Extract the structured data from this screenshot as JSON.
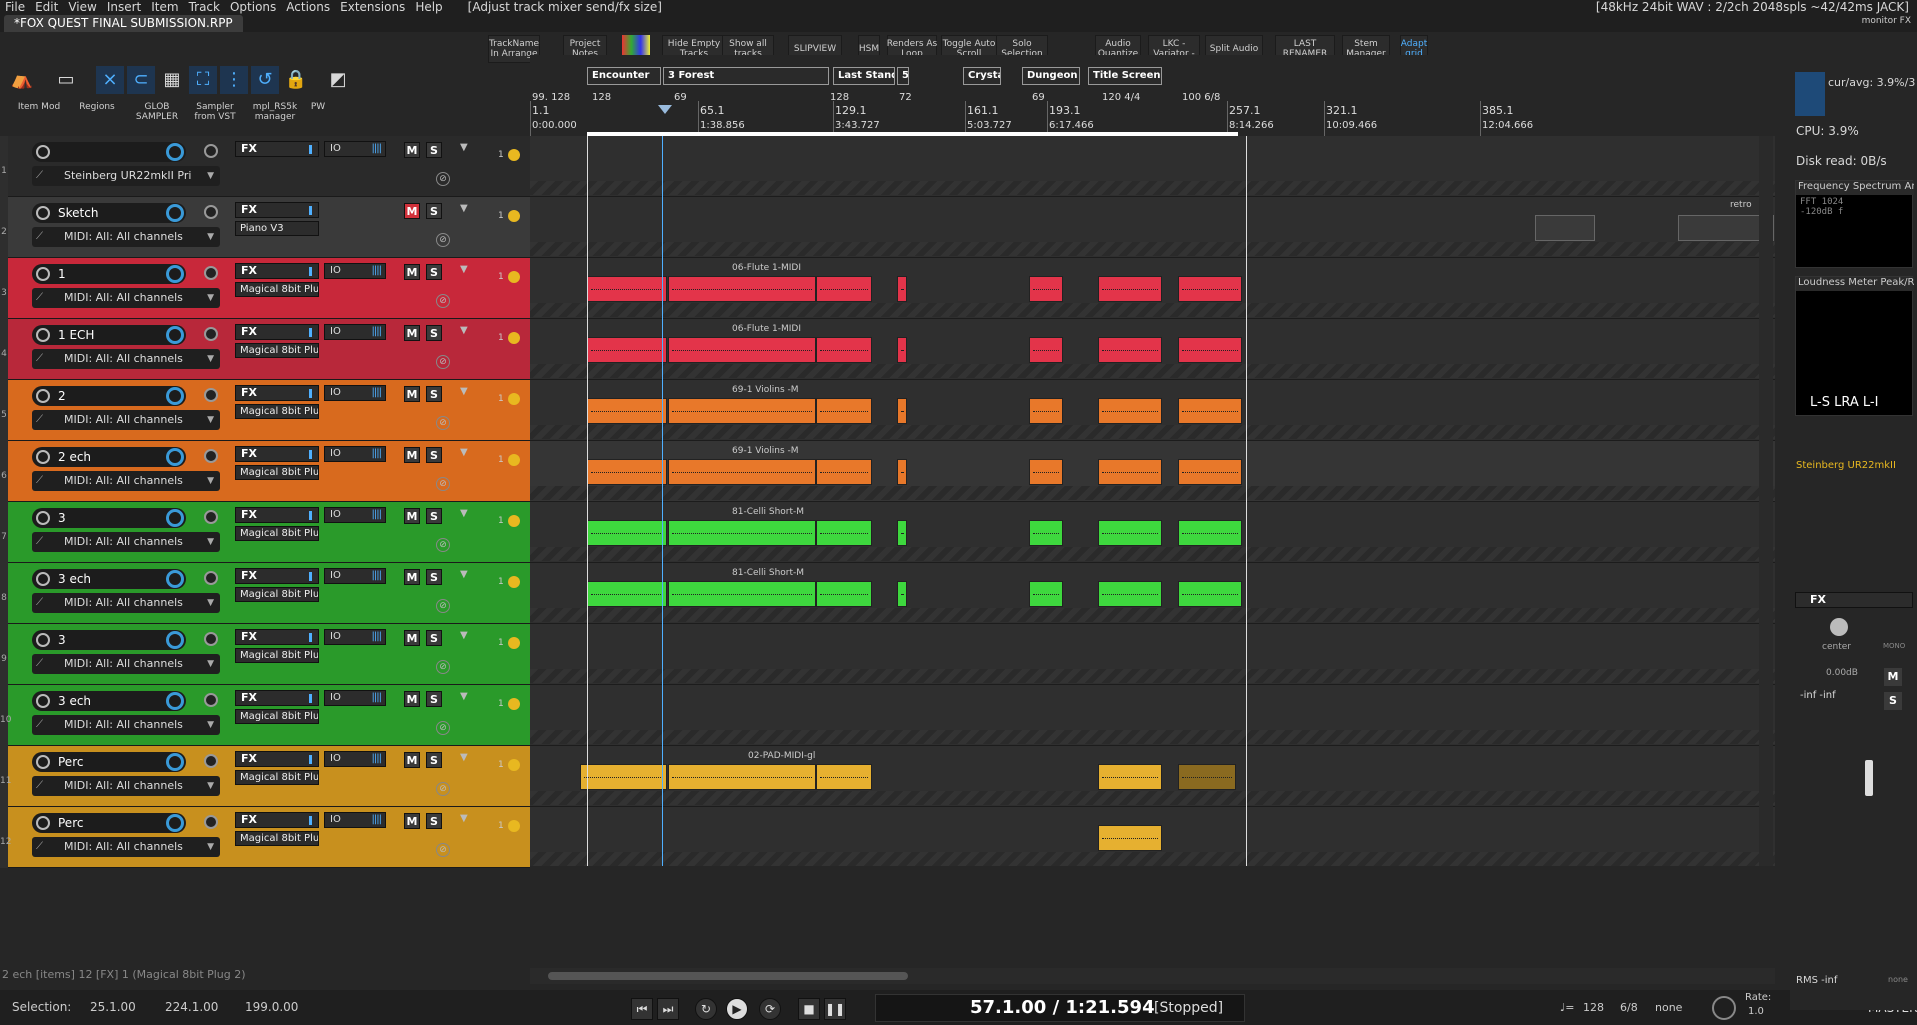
{
  "menu": {
    "items": [
      "File",
      "Edit",
      "View",
      "Insert",
      "Item",
      "Track",
      "Options",
      "Actions",
      "Extensions",
      "Help"
    ],
    "message": "[Adjust track mixer send/fx size]",
    "right": "[48kHz 24bit WAV : 2/2ch 2048spls ~42/42ms JACK]"
  },
  "tab": {
    "title": "*FOX QUEST FINAL SUBMISSION.RPP",
    "monitor": "monitor FX"
  },
  "toolbar": {
    "buttons": [
      {
        "label": "TrackName\nIn Arrange",
        "active": false
      },
      {
        "label": "Project\nNotes",
        "active": false
      },
      {
        "label": "Hide Empty\nTracks",
        "active": false
      },
      {
        "label": "Show all\ntracks",
        "active": false
      },
      {
        "label": "SLIPVIEW",
        "active": false
      },
      {
        "label": "HSM",
        "active": false
      },
      {
        "label": "Renders As\nLoop",
        "active": false
      },
      {
        "label": "Toggle Auto\nScroll",
        "active": false
      },
      {
        "label": "Solo\nSelection",
        "active": false
      },
      {
        "label": "Audio\nQuantize",
        "active": false
      },
      {
        "label": "LKC -\nVariator -",
        "active": false
      },
      {
        "label": "Split Audio",
        "active": false
      },
      {
        "label": "LAST\nRENAMER",
        "active": false
      },
      {
        "label": "Stem\nManager",
        "active": false
      },
      {
        "label": "Adapt\ngrid",
        "active": true
      }
    ],
    "left_labels": [
      "Item Mod",
      "Regions",
      "GLOB\nSAMPLER",
      "Sampler\nfrom VST",
      "mpl_RS5k\nmanager",
      "PW"
    ]
  },
  "tracks": [
    {
      "num": "1",
      "name": "",
      "fx": "FX",
      "io": "IO",
      "plugin": "",
      "route": "Steinberg UR22mkII Pri",
      "color": "#2a2a2a",
      "mute": false,
      "rec": "1"
    },
    {
      "num": "2",
      "name": "Sketch",
      "fx": "FX",
      "io": "",
      "plugin": "Piano V3",
      "route": "MIDI: All: All channels",
      "color": "#3a3a3a",
      "mute": true,
      "rec": "1"
    },
    {
      "num": "3",
      "name": "1",
      "fx": "FX",
      "io": "IO",
      "plugin": "Magical 8bit Plug",
      "route": "MIDI: All: All channels",
      "color": "#c8283a",
      "mute": false,
      "rec": "1"
    },
    {
      "num": "4",
      "name": "1 ECH",
      "fx": "FX",
      "io": "IO",
      "plugin": "Magical 8bit Plug",
      "route": "MIDI: All: All channels",
      "color": "#b8283a",
      "mute": false,
      "rec": "1"
    },
    {
      "num": "5",
      "name": "2",
      "fx": "FX",
      "io": "IO",
      "plugin": "Magical 8bit Plug",
      "route": "MIDI: All: All channels",
      "color": "#d86a1e",
      "mute": false,
      "rec": "1"
    },
    {
      "num": "6",
      "name": "2 ech",
      "fx": "FX",
      "io": "IO",
      "plugin": "Magical 8bit Plug",
      "route": "MIDI: All: All channels",
      "color": "#d86a1e",
      "mute": false,
      "rec": "1"
    },
    {
      "num": "7",
      "name": "3",
      "fx": "FX",
      "io": "IO",
      "plugin": "Magical 8bit Plug",
      "route": "MIDI: All: All channels",
      "color": "#2a9a2a",
      "mute": false,
      "rec": "1"
    },
    {
      "num": "8",
      "name": "3 ech",
      "fx": "FX",
      "io": "IO",
      "plugin": "Magical 8bit Plug",
      "route": "MIDI: All: All channels",
      "color": "#2a9a2a",
      "mute": false,
      "rec": "1"
    },
    {
      "num": "9",
      "name": "3",
      "fx": "FX",
      "io": "IO",
      "plugin": "Magical 8bit Plug",
      "route": "MIDI: All: All channels",
      "color": "#2a9a2a",
      "mute": false,
      "rec": "1"
    },
    {
      "num": "10",
      "name": "3 ech",
      "fx": "FX",
      "io": "IO",
      "plugin": "Magical 8bit Plug",
      "route": "MIDI: All: All channels",
      "color": "#2a9a2a",
      "mute": false,
      "rec": "1"
    },
    {
      "num": "11",
      "name": "Perc",
      "fx": "FX",
      "io": "IO",
      "plugin": "Magical 8bit Plug",
      "route": "MIDI: All: All channels",
      "color": "#c8901e",
      "mute": false,
      "rec": "1"
    },
    {
      "num": "12",
      "name": "Perc",
      "fx": "FX",
      "io": "IO",
      "plugin": "Magical 8bit Plug",
      "route": "MIDI: All: All channels",
      "color": "#c8901e",
      "mute": false,
      "rec": "1"
    }
  ],
  "regions": [
    "Encounter",
    "3 Forest",
    "Last Stand",
    "5",
    "Crysta",
    "Dungeon",
    "Title Screen"
  ],
  "ruler": {
    "marks": [
      {
        "bar": "1.1",
        "time": "0:00.000"
      },
      {
        "bar": "65.1",
        "time": "1:38.856"
      },
      {
        "bar": "129.1",
        "time": "3:43.727"
      },
      {
        "bar": "161.1",
        "time": "5:03.727"
      },
      {
        "bar": "193.1",
        "time": "6:17.466"
      },
      {
        "bar": "257.1",
        "time": "8:14.266"
      },
      {
        "bar": "321.1",
        "time": "10:09.466"
      },
      {
        "bar": "385.1",
        "time": "12:04.666"
      }
    ],
    "tempos": [
      "99. 128",
      "128",
      "69",
      "128",
      "72",
      "69",
      "120 4/4",
      "100 6/8"
    ]
  },
  "item_names": {
    "flute": "06-Flute 1-MIDI",
    "violins": "69-1 Violins -M",
    "celli": "81-Celli Short-M",
    "pad": "02-PAD-MIDI-gl",
    "retro": "retro"
  },
  "status_line": "2 ech [items] 12 [FX] 1 (Magical 8bit Plug 2)",
  "selection": {
    "label": "Selection:",
    "start": "25.1.00",
    "end": "224.1.00",
    "length": "199.0.00"
  },
  "transport": {
    "time": "57.1.00 / 1:21.594",
    "state": "[Stopped]",
    "bpm": "128",
    "sig": "6/8",
    "snap": "none",
    "rate_label": "Rate:",
    "rate": "1.0"
  },
  "right": {
    "cpu_avg": "cur/avg: 3.9%/3",
    "cpu": "CPU: 3.9%",
    "disk": "Disk read: 0B/s",
    "spectrum": "Frequency Spectrum An",
    "fft": "FFT 1024\n-120dB f",
    "loudness": "Loudness Meter Peak/RI",
    "ls": "L-S  LRA  L-I",
    "device": "Steinberg UR22mkII",
    "fx": "FX",
    "center": "center",
    "mono": "MONO",
    "db": "0.00dB",
    "inf": "-inf  -inf",
    "rms": "RMS  -inf",
    "none": "none",
    "master": "MASTER",
    "m": "M",
    "s": "S"
  }
}
